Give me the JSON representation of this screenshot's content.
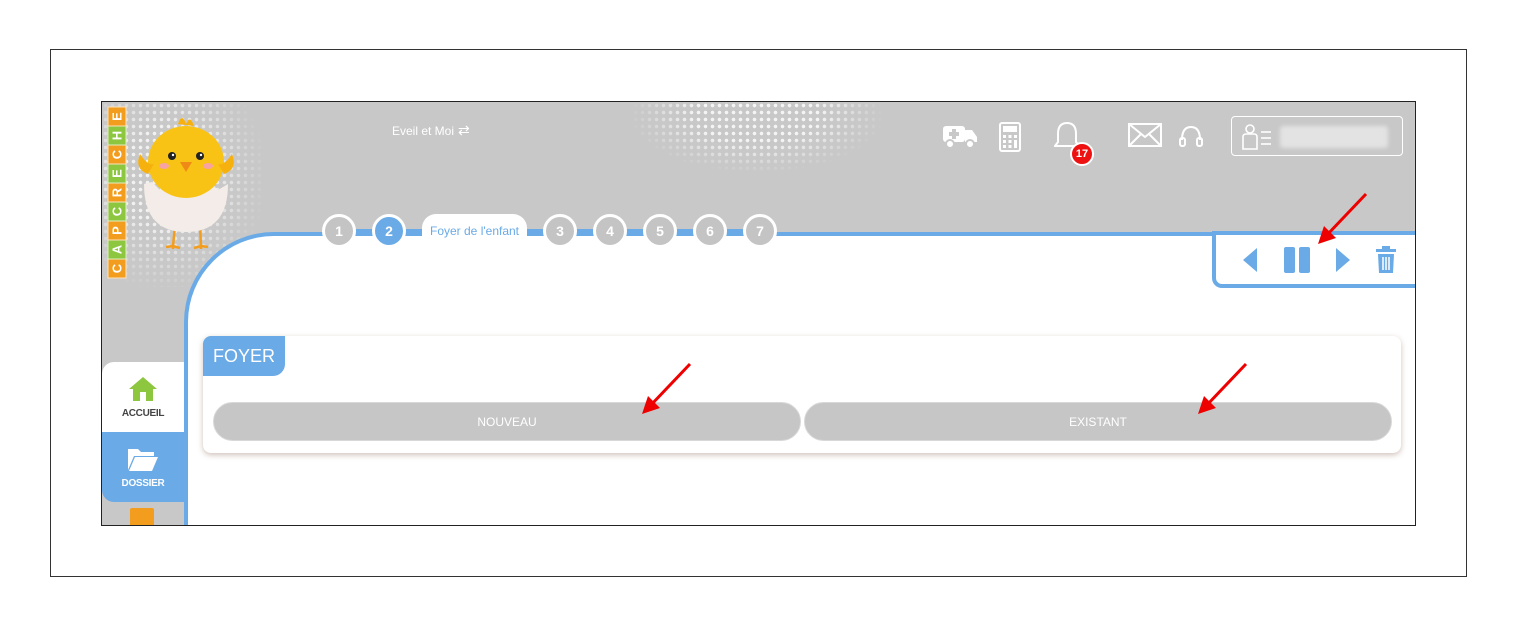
{
  "brand": {
    "logo_letters": [
      "C",
      "A",
      "P",
      "C",
      "R",
      "E",
      "C",
      "H",
      "E"
    ],
    "logo_colors": [
      "#f39d1e",
      "#8dc63f",
      "#f39d1e",
      "#8dc63f",
      "#f39d1e",
      "#8dc63f",
      "#f39d1e",
      "#8dc63f",
      "#f39d1e"
    ]
  },
  "header": {
    "site_name": "Eveil et Moi",
    "switch_icon": "⇄",
    "notification_count": "17",
    "icons": [
      "ambulance-icon",
      "calculator-icon",
      "bell-icon",
      "mail-icon",
      "headset-icon",
      "user-icon"
    ]
  },
  "steps": {
    "items": [
      "1",
      "2",
      "3",
      "4",
      "5",
      "6",
      "7"
    ],
    "active_index": 1,
    "active_label": "Foyer de l'enfant"
  },
  "sidebar": {
    "items": [
      {
        "label": "ACCUEIL",
        "icon": "home-icon"
      },
      {
        "label": "DOSSIER",
        "icon": "folder-icon"
      }
    ]
  },
  "foyer": {
    "title": "FOYER",
    "nouveau_label": "NOUVEAU",
    "existant_label": "EXISTANT"
  },
  "colors": {
    "accent": "#6aaae6",
    "header_bg": "#c8c8c8",
    "button_bg": "#c6c6c6",
    "badge": "#e11111",
    "annotation_arrow": "#e00000"
  }
}
